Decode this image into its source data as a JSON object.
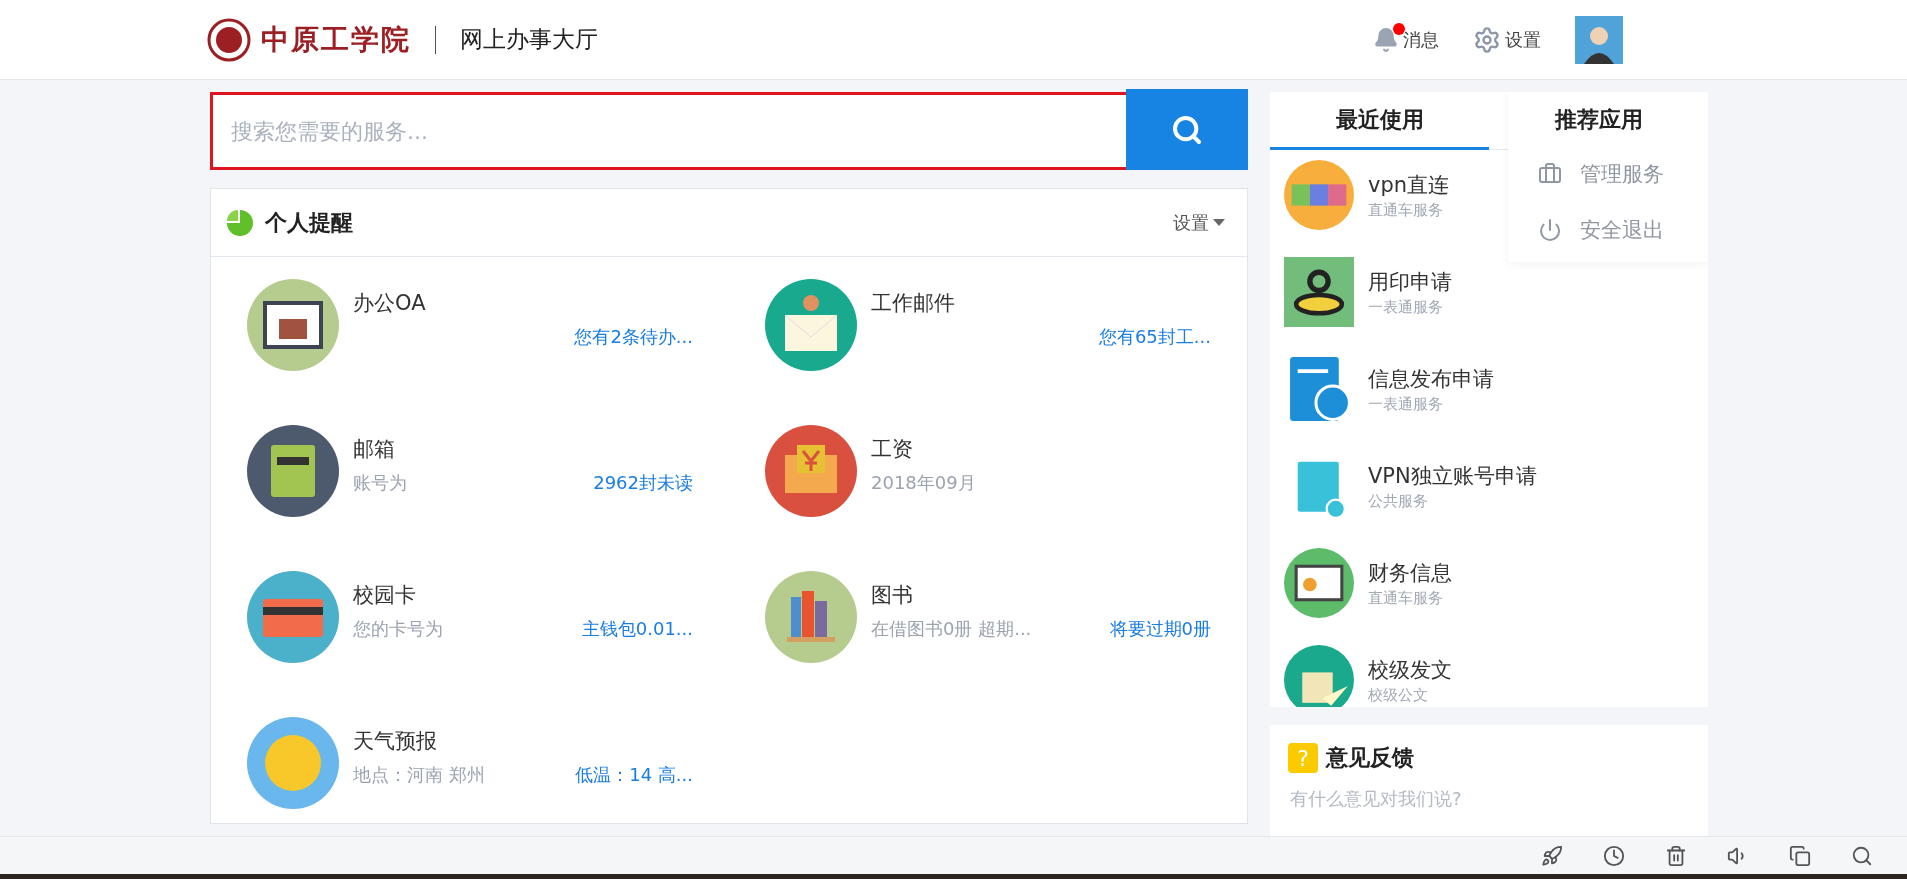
{
  "header": {
    "logo_text": "中原工学院",
    "title": "网上办事大厅",
    "notifications": {
      "label": "消息",
      "unread": true
    },
    "settings": {
      "label": "设置"
    }
  },
  "search": {
    "placeholder": "搜索您需要的服务...",
    "highlighted": true
  },
  "reminders": {
    "title": "个人提醒",
    "settings": "设置",
    "items": [
      {
        "kind": "oa",
        "title": "办公OA",
        "link": "您有2条待办..."
      },
      {
        "kind": "mail",
        "title": "工作邮件",
        "link": "您有65封工..."
      },
      {
        "kind": "mailbox",
        "title": "邮箱",
        "detail": "账号为",
        "link": "2962封未读"
      },
      {
        "kind": "salary",
        "title": "工资",
        "detail": "2018年09月"
      },
      {
        "kind": "card",
        "title": "校园卡",
        "detail": "您的卡号为",
        "link": "主钱包0.01..."
      },
      {
        "kind": "books",
        "title": "图书",
        "detail": "在借图书0册 超期...",
        "link": "将要过期0册"
      },
      {
        "kind": "weather",
        "title": "天气预报",
        "detail": "地点：河南 郑州",
        "link": "低温：14 高..."
      }
    ]
  },
  "tabs": [
    {
      "label": "最近使用",
      "selected": true
    },
    {
      "label": "推荐应用",
      "selected": false
    }
  ],
  "user_menu": {
    "items": [
      {
        "kind": "manage",
        "label": "管理服务"
      },
      {
        "kind": "logout",
        "label": "安全退出"
      }
    ]
  },
  "recent": [
    {
      "kind": "vpn",
      "name": "vpn直连",
      "category": "直通车服务"
    },
    {
      "kind": "stamp",
      "name": "用印申请",
      "category": "一表通服务"
    },
    {
      "kind": "publish",
      "name": "信息发布申请",
      "category": "一表通服务"
    },
    {
      "kind": "vpnaccount",
      "name": "VPN独立账号申请",
      "category": "公共服务"
    },
    {
      "kind": "finance",
      "name": "财务信息",
      "category": "直通车服务"
    },
    {
      "kind": "document",
      "name": "校级发文",
      "category": "校级公文"
    }
  ],
  "feedback": {
    "icon": "?",
    "title": "意见反馈",
    "placeholder": "有什么意见对我们说?"
  }
}
